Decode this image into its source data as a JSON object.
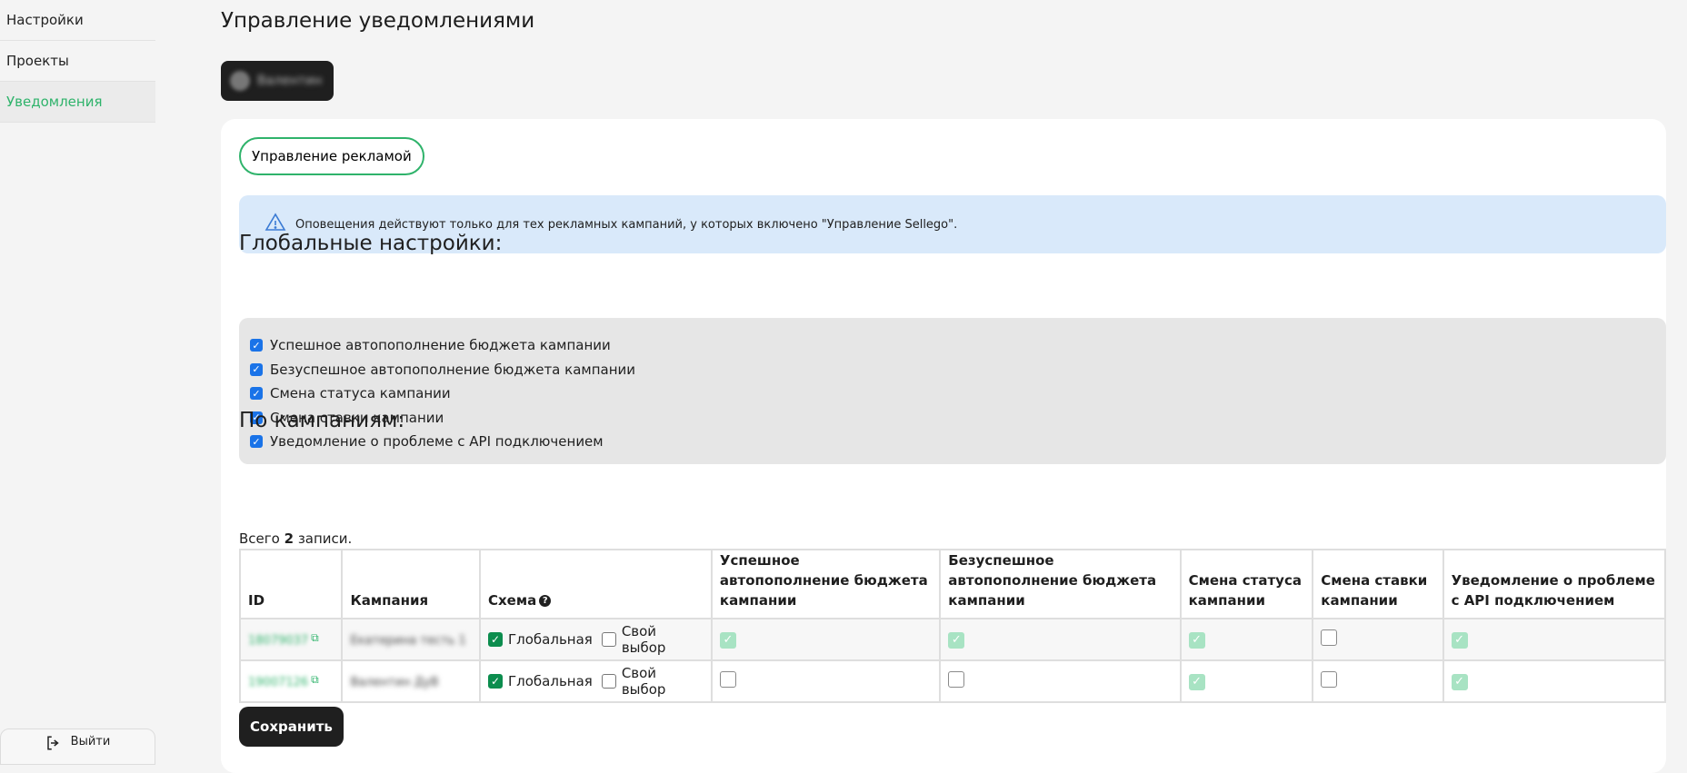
{
  "sidebar": {
    "items": [
      {
        "label": "Настройки"
      },
      {
        "label": "Проекты"
      },
      {
        "label": "Уведомления"
      }
    ],
    "logout_label": "Выйти"
  },
  "page": {
    "title": "Управление уведомлениями",
    "user_name": "Валентин"
  },
  "tab": {
    "label": "Управление рекламой"
  },
  "alert": {
    "text": "Оповещения действуют только для тех рекламных кампаний, у которых включено \"Управление Sellego\"."
  },
  "global": {
    "title": "Глобальные настройки:",
    "options": [
      {
        "label": "Успешное автопополнение бюджета кампании",
        "checked": true
      },
      {
        "label": "Безуспешное автопополнение бюджета кампании",
        "checked": true
      },
      {
        "label": "Смена статуса кампании",
        "checked": true
      },
      {
        "label": "Смена ставки кампании",
        "checked": true
      },
      {
        "label": "Уведомление о проблеме с API подключением",
        "checked": true
      }
    ]
  },
  "campaigns": {
    "title": "По кампаниям:",
    "total_prefix": "Всего",
    "total_count": "2",
    "total_suffix": "записи.",
    "headers": {
      "id": "ID",
      "campaign": "Кампания",
      "scheme": "Схема",
      "success": "Успешное автопополнение бюджета кампании",
      "fail": "Безуспешное автопополнение бюджета кампании",
      "status": "Смена статуса кампании",
      "bid": "Смена ставки кампании",
      "api": "Уведомление о проблеме с API подключением"
    },
    "scheme_labels": {
      "global": "Глобальная",
      "custom": "Свой выбор"
    },
    "rows": [
      {
        "id": "18079037",
        "name": "Екатерина тесть 1",
        "global": true,
        "custom": false,
        "success": true,
        "fail": true,
        "status": true,
        "bid": false,
        "api": true
      },
      {
        "id": "19007126",
        "name": "Валентин ДуВ",
        "global": true,
        "custom": false,
        "success": false,
        "fail": false,
        "status": true,
        "bid": false,
        "api": true
      }
    ]
  },
  "save_label": "Сохранить",
  "colors": {
    "accent": "#2fb36b",
    "alert_bg": "#d9e9fa",
    "dark": "#1f1f1f"
  }
}
